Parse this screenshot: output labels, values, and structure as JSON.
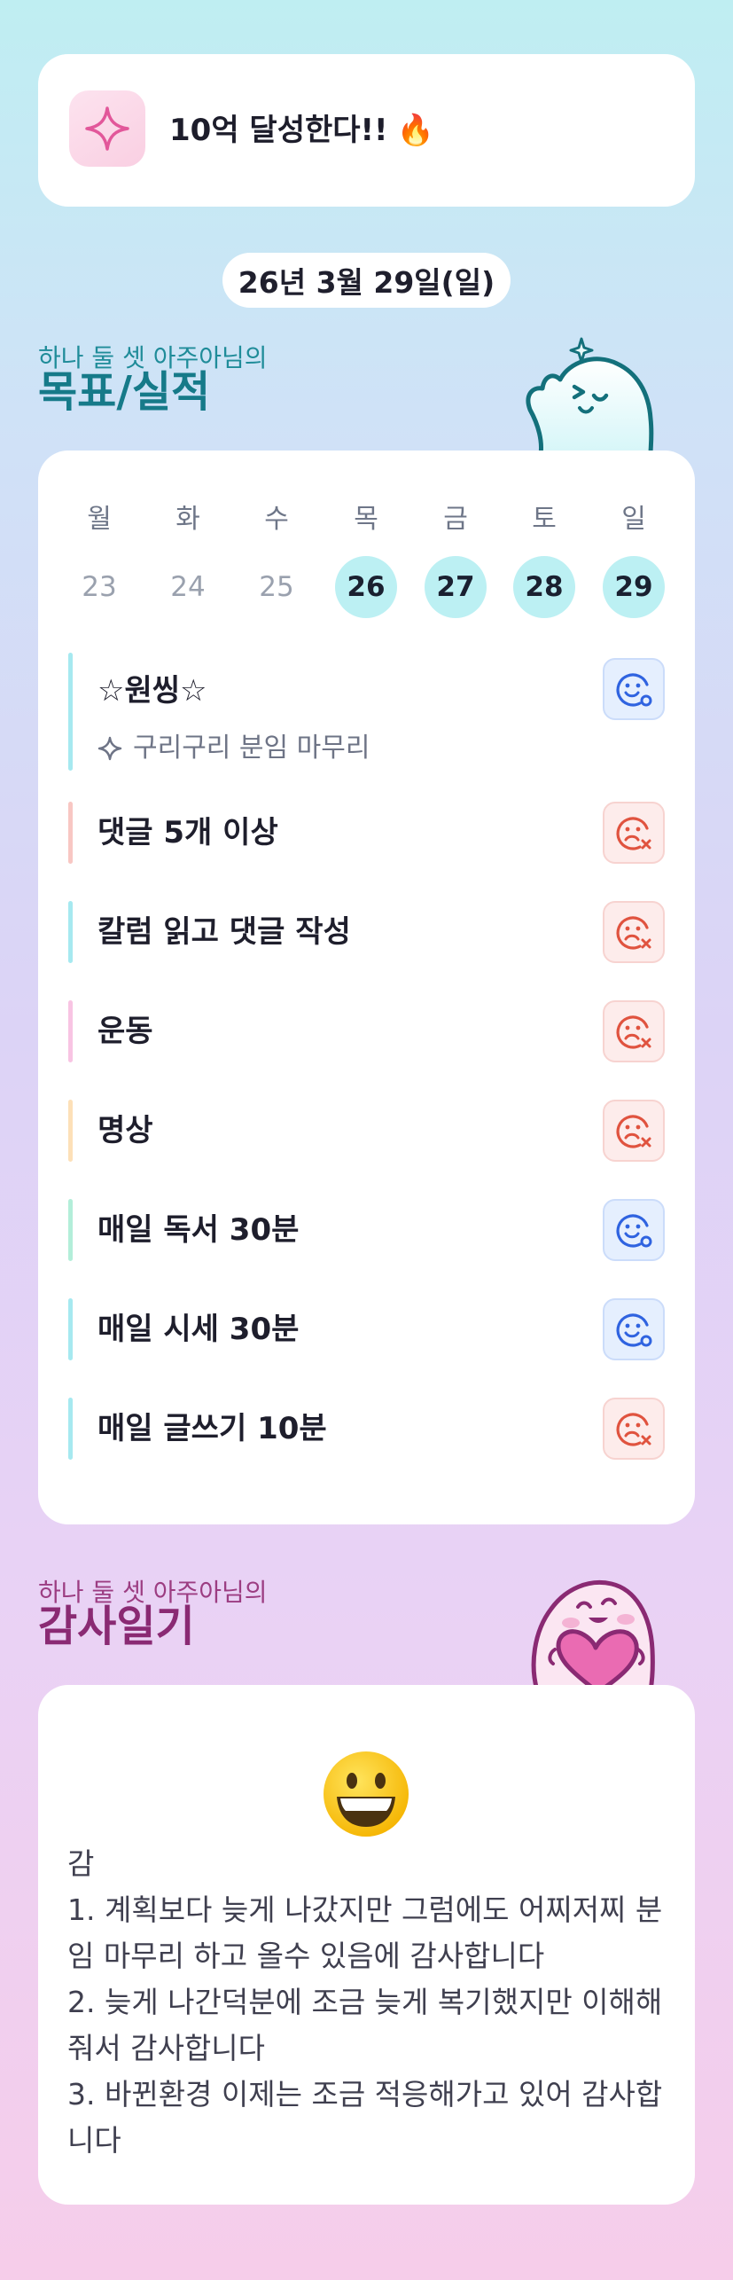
{
  "goal": {
    "text": "10억 달성한다!!",
    "emoji": "🔥",
    "icon": "sparkle-icon"
  },
  "date": "26년 3월 29일(일)",
  "goals_section": {
    "subtitle": "하나 둘 셋 아주아님의",
    "title": "목표/실적"
  },
  "week": {
    "days": [
      "월",
      "화",
      "수",
      "목",
      "금",
      "토",
      "일"
    ],
    "dates": [
      "23",
      "24",
      "25",
      "26",
      "27",
      "28",
      "29"
    ],
    "active": [
      false,
      false,
      false,
      true,
      true,
      true,
      true
    ]
  },
  "tasks": [
    {
      "label": "☆원씽☆",
      "sub": "구리구리 분임 마무리",
      "status": "happy",
      "bar_color": "#a6e9f0"
    },
    {
      "label": "댓글 5개 이상",
      "status": "sad",
      "bar_color": "#f8c7c3"
    },
    {
      "label": "칼럼 읽고 댓글 작성",
      "status": "sad",
      "bar_color": "#a6e9f0"
    },
    {
      "label": "운동",
      "status": "sad",
      "bar_color": "#f8c4e3"
    },
    {
      "label": "명상",
      "status": "sad",
      "bar_color": "#fde0b8"
    },
    {
      "label": "매일 독서 30분",
      "status": "happy",
      "bar_color": "#b3eed9"
    },
    {
      "label": "매일 시세 30분",
      "status": "happy",
      "bar_color": "#a6e9f0"
    },
    {
      "label": "매일 글쓰기 10분",
      "status": "sad",
      "bar_color": "#a6e9f0"
    }
  ],
  "gratitude_section": {
    "subtitle": "하나 둘 셋 아주아님의",
    "title": "감사일기"
  },
  "gratitude": {
    "emoji": "grinning-face-icon",
    "text": "감\n1. 계획보다 늦게 나갔지만 그럼에도 어찌저찌 분임 마무리 하고 올수 있음에 감사합니다\n2. 늦게 나간덕분에 조금 늦게 복기했지만 이해해줘서 감사합니다\n3. 바뀐환경 이제는 조금 적응해가고 있어 감사합니다"
  }
}
